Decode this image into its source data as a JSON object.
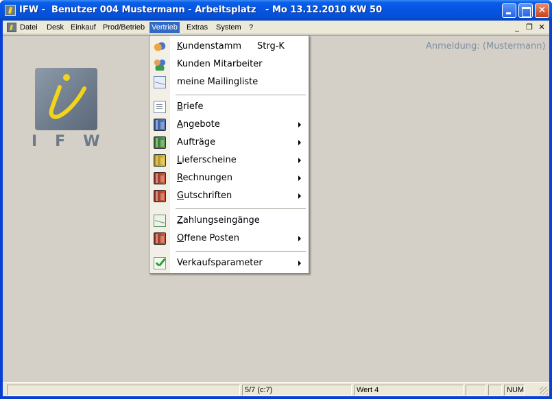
{
  "window": {
    "title": "IFW -  Benutzer 004 Mustermann - Arbeitsplatz   - Mo 13.12.2010 KW 50",
    "minimize_glyph": "_",
    "maximize_glyph": "□",
    "close_glyph": "✕"
  },
  "menubar": {
    "items": [
      "Datei",
      "Desk",
      "Einkauf",
      "Prod/Betrieb",
      "Vertrieb",
      "Extras",
      "System",
      "?"
    ],
    "active": "Vertrieb",
    "mdi_buttons": [
      "_",
      "❐",
      "✕"
    ]
  },
  "workspace": {
    "login_text": "Anmeldung: (Mustermann)",
    "logo_text": "IFW"
  },
  "dropdown": {
    "items": [
      {
        "label": "Kundenstamm",
        "shortcut": "Strg-K",
        "icon": "handshake-icon"
      },
      {
        "label": "Kunden Mitarbeiter",
        "icon": "people-icon"
      },
      {
        "label": "meine Mailingliste",
        "icon": "mailing-icon"
      },
      {
        "label": "Briefe",
        "icon": "document-icon"
      },
      {
        "label": "Angebote",
        "icon": "blue-folder-icon",
        "submenu": true
      },
      {
        "label": "Aufträge",
        "icon": "green-folder-icon",
        "submenu": true
      },
      {
        "label": "Lieferscheine",
        "icon": "yellow-folder-icon",
        "submenu": true
      },
      {
        "label": "Rechnungen",
        "icon": "red-folder-icon",
        "submenu": true
      },
      {
        "label": "Gutschriften",
        "icon": "red-folder-icon",
        "submenu": true
      },
      {
        "label": "Zahlungseingänge",
        "icon": "payment-mail-icon"
      },
      {
        "label": "Offene Posten",
        "icon": "red-folder-icon",
        "submenu": true
      },
      {
        "label": "Verkaufsparameter",
        "icon": "checkmark-icon",
        "submenu": true
      }
    ]
  },
  "statusbar": {
    "record": "5/7 (c:7)",
    "value": "Wert 4",
    "num": "NUM"
  }
}
